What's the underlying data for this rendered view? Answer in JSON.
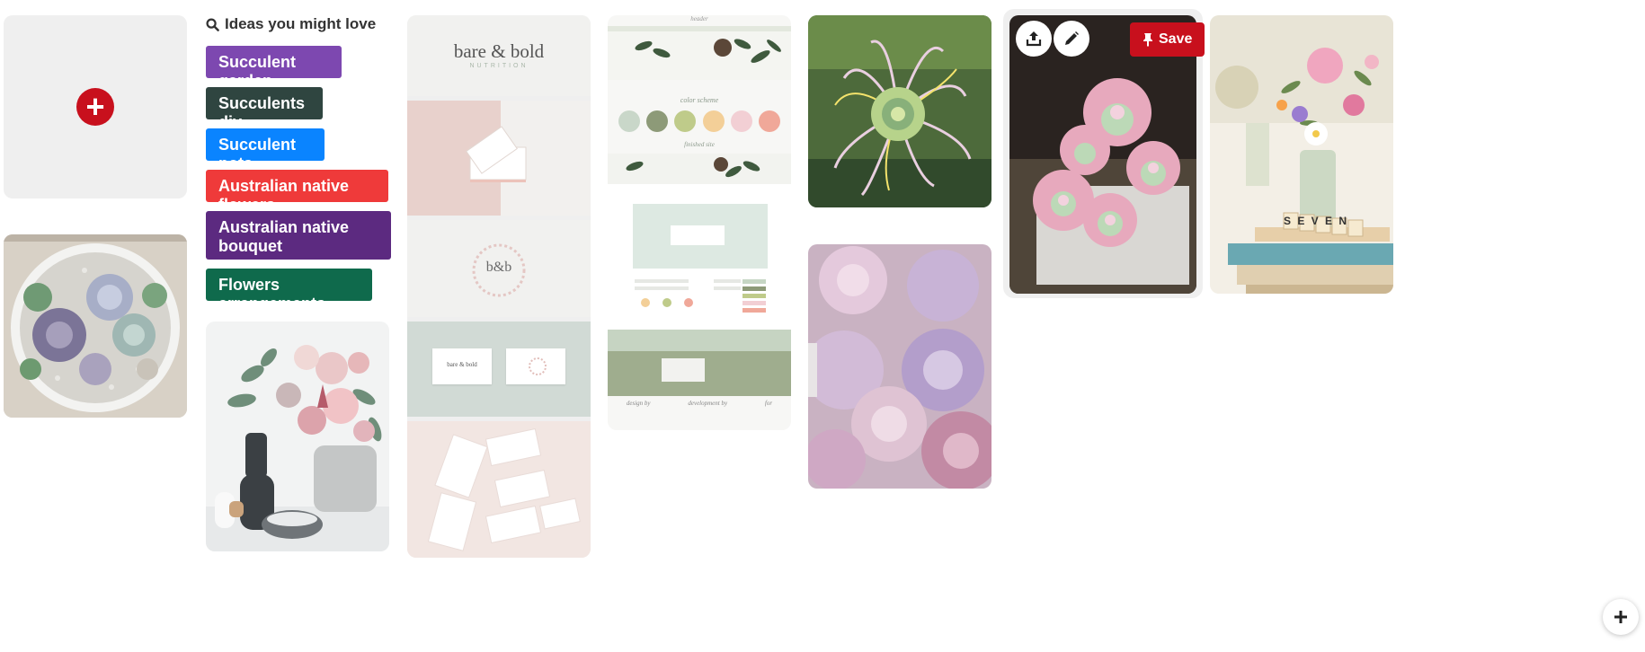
{
  "ideas": {
    "heading": "Ideas you might love",
    "chips": [
      {
        "label": "Succulent garden",
        "color": "#7d48b0"
      },
      {
        "label": "Succulents diy",
        "color": "#2f4540"
      },
      {
        "label": "Succulent pots",
        "color": "#0a84ff"
      },
      {
        "label": "Australian native flowers",
        "color": "#ef3a3a"
      },
      {
        "label": "Australian native bouquet",
        "color": "#5c2a80"
      },
      {
        "label": "Flowers arrangements",
        "color": "#0f6a4c"
      }
    ]
  },
  "brand_board": {
    "logo_line1": "bare & bold",
    "logo_line2": "NUTRITION",
    "monogram": "b&b",
    "card_text": "bare & bold"
  },
  "style_board": {
    "header_label": "header",
    "color_scheme_label": "color scheme",
    "finished_site_label": "finished site",
    "footer_labels": [
      "design by",
      "development by",
      "for"
    ],
    "swatches": [
      "#c9d7c9",
      "#8d9a78",
      "#bfcb8a",
      "#f3cf98",
      "#f2cfd4",
      "#f0a899"
    ]
  },
  "overlay": {
    "save_label": "Save"
  },
  "scrabble_text": "S E V E N",
  "colors": {
    "accent_red": "#c8101d"
  }
}
